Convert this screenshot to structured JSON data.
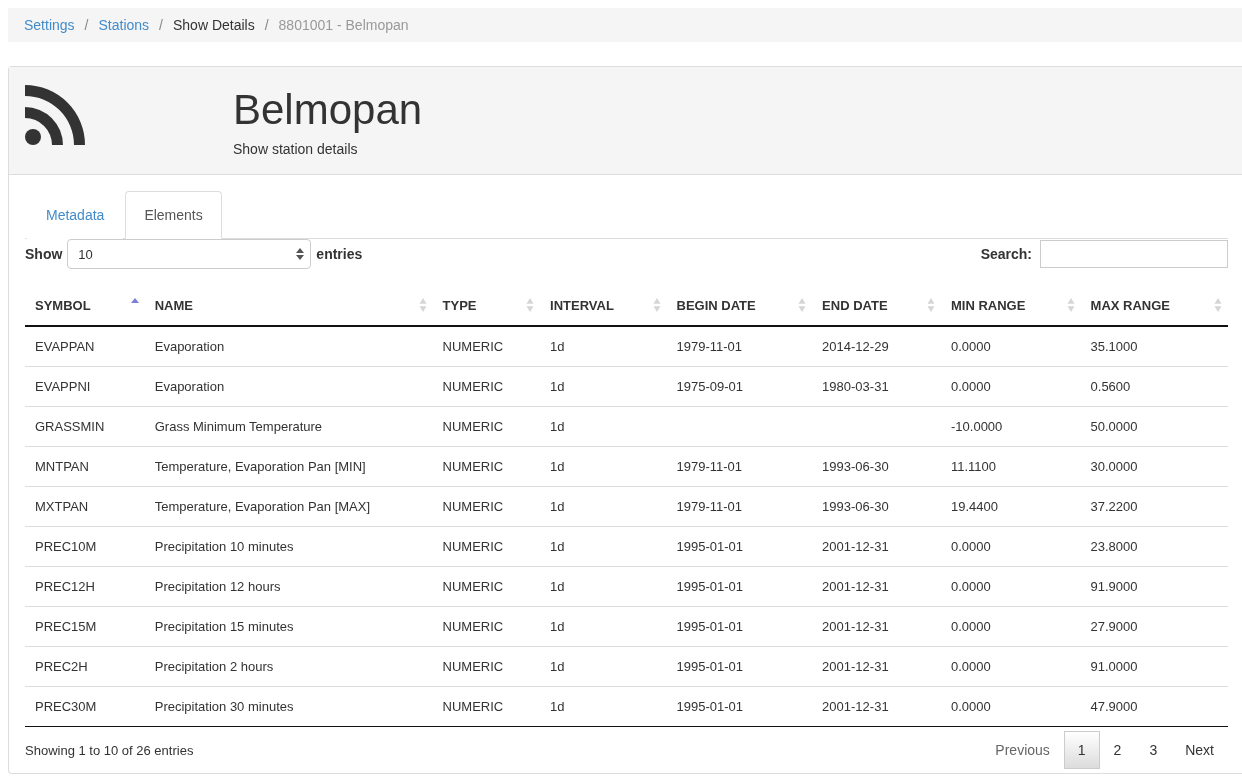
{
  "breadcrumb_separator": "/",
  "breadcrumb": [
    {
      "label": "Settings",
      "kind": "link"
    },
    {
      "label": "Stations",
      "kind": "link"
    },
    {
      "label": "Show Details",
      "kind": "text"
    },
    {
      "label": "8801001 - Belmopan",
      "kind": "current"
    }
  ],
  "header": {
    "title": "Belmopan",
    "subtitle": "Show station details"
  },
  "tabs": [
    {
      "label": "Metadata",
      "selected": false
    },
    {
      "label": "Elements",
      "selected": true
    }
  ],
  "length": {
    "label": "Show",
    "value": "10",
    "suffix": "entries"
  },
  "search": {
    "label": "Search:"
  },
  "table": {
    "columns": [
      {
        "label": "SYMBOL",
        "sorted": true
      },
      {
        "label": "NAME",
        "sorted": false
      },
      {
        "label": "TYPE",
        "sorted": false
      },
      {
        "label": "INTERVAL",
        "sorted": false
      },
      {
        "label": "BEGIN DATE",
        "sorted": false
      },
      {
        "label": "END DATE",
        "sorted": false
      },
      {
        "label": "MIN RANGE",
        "sorted": false
      },
      {
        "label": "MAX RANGE",
        "sorted": false
      }
    ],
    "rows": [
      [
        "EVAPPAN",
        "Evaporation",
        "NUMERIC",
        "1d",
        "1979-11-01",
        "2014-12-29",
        "0.0000",
        "35.1000"
      ],
      [
        "EVAPPNI",
        "Evaporation",
        "NUMERIC",
        "1d",
        "1975-09-01",
        "1980-03-31",
        "0.0000",
        "0.5600"
      ],
      [
        "GRASSMIN",
        "Grass Minimum Temperature",
        "NUMERIC",
        "1d",
        "",
        "",
        "-10.0000",
        "50.0000"
      ],
      [
        "MNTPAN",
        "Temperature, Evaporation Pan [MIN]",
        "NUMERIC",
        "1d",
        "1979-11-01",
        "1993-06-30",
        "11.1100",
        "30.0000"
      ],
      [
        "MXTPAN",
        "Temperature, Evaporation Pan [MAX]",
        "NUMERIC",
        "1d",
        "1979-11-01",
        "1993-06-30",
        "19.4400",
        "37.2200"
      ],
      [
        "PREC10M",
        "Precipitation 10 minutes",
        "NUMERIC",
        "1d",
        "1995-01-01",
        "2001-12-31",
        "0.0000",
        "23.8000"
      ],
      [
        "PREC12H",
        "Precipitation 12 hours",
        "NUMERIC",
        "1d",
        "1995-01-01",
        "2001-12-31",
        "0.0000",
        "91.9000"
      ],
      [
        "PREC15M",
        "Precipitation 15 minutes",
        "NUMERIC",
        "1d",
        "1995-01-01",
        "2001-12-31",
        "0.0000",
        "27.9000"
      ],
      [
        "PREC2H",
        "Precipitation 2 hours",
        "NUMERIC",
        "1d",
        "1995-01-01",
        "2001-12-31",
        "0.0000",
        "91.0000"
      ],
      [
        "PREC30M",
        "Precipitation 30 minutes",
        "NUMERIC",
        "1d",
        "1995-01-01",
        "2001-12-31",
        "0.0000",
        "47.9000"
      ]
    ]
  },
  "info": "Showing 1 to 10 of 26 entries",
  "pagination": {
    "previous": {
      "label": "Previous",
      "disabled": true
    },
    "pages": [
      {
        "label": "1",
        "selected": true
      },
      {
        "label": "2",
        "selected": false
      },
      {
        "label": "3",
        "selected": false
      }
    ],
    "next": {
      "label": "Next",
      "disabled": false
    }
  }
}
